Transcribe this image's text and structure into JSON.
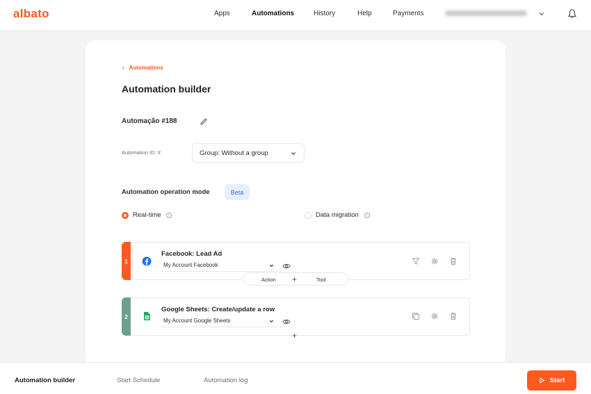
{
  "header": {
    "logo": "albato",
    "nav": [
      "Apps",
      "Automations",
      "History",
      "Help",
      "Payments"
    ],
    "active_nav": "Automations"
  },
  "breadcrumb": {
    "label": "Automations"
  },
  "page": {
    "title": "Automation builder",
    "automation_name": "Automação #188",
    "id_label": "Automation ID: #",
    "group_select": "Group: Without a group",
    "mode_label": "Automation operation mode",
    "beta_badge": "Beta",
    "modes": [
      {
        "label": "Real-time",
        "selected": true,
        "info": "i"
      },
      {
        "label": "Data migration",
        "selected": false,
        "info": "i"
      }
    ]
  },
  "steps": [
    {
      "number": "1",
      "title": "Facebook: Lead Ad",
      "account": "My Account Facebook",
      "color": "#ff5a1f",
      "icon": "facebook-icon",
      "actions": [
        "filter-icon",
        "gear-icon",
        "trash-icon"
      ]
    },
    {
      "number": "2",
      "title": "Google Sheets: Create/update a row",
      "account": "My Account Google Sheets",
      "color": "#6fa08f",
      "icon": "google-sheets-icon",
      "actions": [
        "copy-icon",
        "gear-icon",
        "trash-icon"
      ]
    }
  ],
  "connector": {
    "action_label": "Action",
    "plus": "+",
    "tool_label": "Tool"
  },
  "bottom_bar": {
    "tabs": [
      "Automation builder",
      "Start Schedule",
      "Automation log"
    ],
    "active_tab": "Automation builder",
    "start_label": "Start"
  },
  "colors": {
    "accent": "#ff5a1f",
    "beta_bg": "#e7effd",
    "beta_text": "#3f6ad8",
    "facebook": "#1877f2",
    "sheets": "#21a464"
  }
}
